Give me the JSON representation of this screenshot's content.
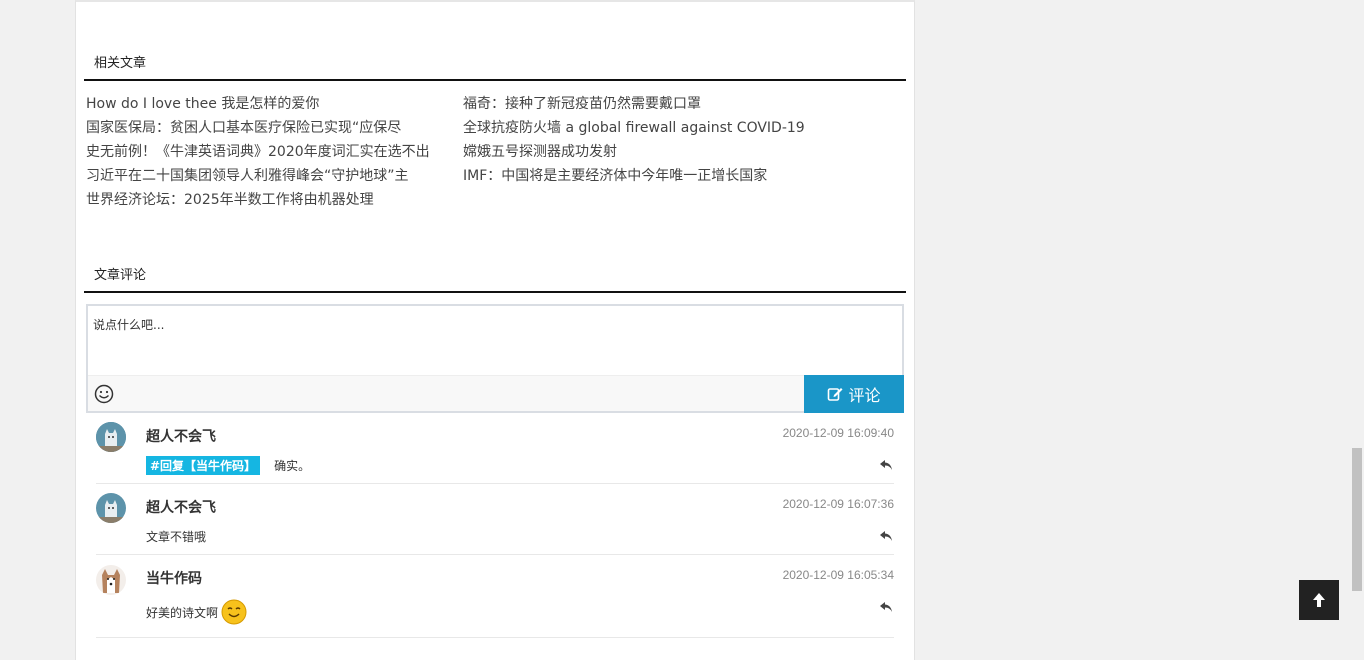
{
  "related": {
    "title": "相关文章",
    "left": [
      "How do I love thee 我是怎样的爱你",
      "国家医保局：贫困人口基本医疗保险已实现“应保尽",
      "史无前例！《牛津英语词典》2020年度词汇实在选不出",
      "习近平在二十国集团领导人利雅得峰会“守护地球”主",
      "世界经济论坛：2025年半数工作将由机器处理"
    ],
    "right": [
      "福奇：接种了新冠疫苗仍然需要戴口罩",
      "全球抗疫防火墙 a global firewall against COVID-19",
      "嫦娥五号探测器成功发射",
      "IMF：中国将是主要经济体中今年唯一正增长国家"
    ]
  },
  "comments_section": {
    "title": "文章评论",
    "input_text": "说点什么吧...",
    "submit_label": "评论",
    "emoji_icon": "smile-icon",
    "submit_icon": "edit-icon"
  },
  "comments": [
    {
      "name": "超人不会飞",
      "time": "2020-12-09 16:09:40",
      "tag": "#回复【当牛作码】",
      "text": "确实。",
      "avatar": "husky-avatar-blue"
    },
    {
      "name": "超人不会飞",
      "time": "2020-12-09 16:07:36",
      "tag": "",
      "text": "文章不错哦",
      "avatar": "husky-avatar-blue"
    },
    {
      "name": "当牛作码",
      "time": "2020-12-09 16:05:34",
      "tag": "",
      "text": "好美的诗文啊",
      "avatar": "husky-avatar-dog",
      "emoji": "smile-emoji"
    }
  ],
  "colors": {
    "accent": "#1a96c8",
    "tag": "#15b6e2",
    "back_to_top": "#222222"
  },
  "back_to_top_icon": "arrow-up-icon"
}
